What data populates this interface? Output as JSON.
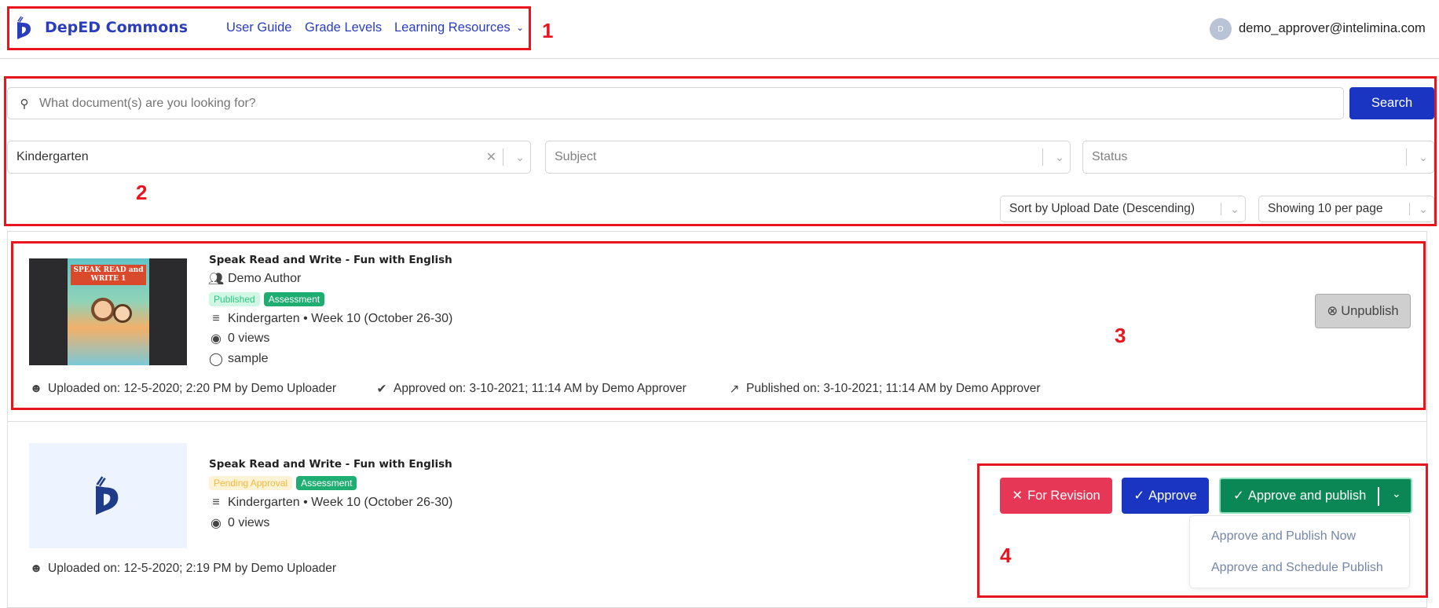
{
  "header": {
    "brand": "DepED Commons",
    "nav": [
      "User Guide",
      "Grade Levels",
      "Learning Resources"
    ],
    "user_initial": "D",
    "user_email": "demo_approver@intelimina.com"
  },
  "search": {
    "placeholder": "What document(s) are you looking for?",
    "button": "Search"
  },
  "filters": {
    "grade": "Kindergarten",
    "subject_placeholder": "Subject",
    "status_placeholder": "Status",
    "sort": "Sort by Upload Date (Descending)",
    "per_page": "Showing 10 per page"
  },
  "annotations": [
    "1",
    "2",
    "3",
    "4"
  ],
  "items": [
    {
      "title": "Speak Read and Write - Fun with English",
      "author": "Demo Author",
      "status": "Published",
      "type": "Assessment",
      "grade_week": "Kindergarten • Week 10 (October 26-30)",
      "views": "0 views",
      "tag": "sample",
      "uploaded": "Uploaded on: 12-5-2020; 2:20 PM by Demo Uploader",
      "approved": "Approved on: 3-10-2021; 11:14 AM by Demo Approver",
      "published": "Published on: 3-10-2021; 11:14 AM by Demo Approver",
      "action": "Unpublish",
      "cover_text": "SPEAK READ and WRITE 1"
    },
    {
      "title": "Speak Read and Write - Fun with English",
      "status": "Pending Approval",
      "type": "Assessment",
      "grade_week": "Kindergarten • Week 10 (October 26-30)",
      "views": "0 views",
      "uploaded": "Uploaded on: 12-5-2020; 2:19 PM by Demo Uploader",
      "actions": {
        "revision": "For Revision",
        "approve": "Approve",
        "approve_publish": "Approve and publish",
        "menu": [
          "Approve and Publish Now",
          "Approve and Schedule Publish"
        ]
      }
    }
  ],
  "colors": {
    "brand": "#2a3dbf",
    "revision": "#e63757",
    "approve": "#1a35c2",
    "publish": "#0a8754",
    "published_badge": "#cff7e4",
    "pending_badge": "#fff3d6",
    "assessment_badge": "#1fae72"
  }
}
